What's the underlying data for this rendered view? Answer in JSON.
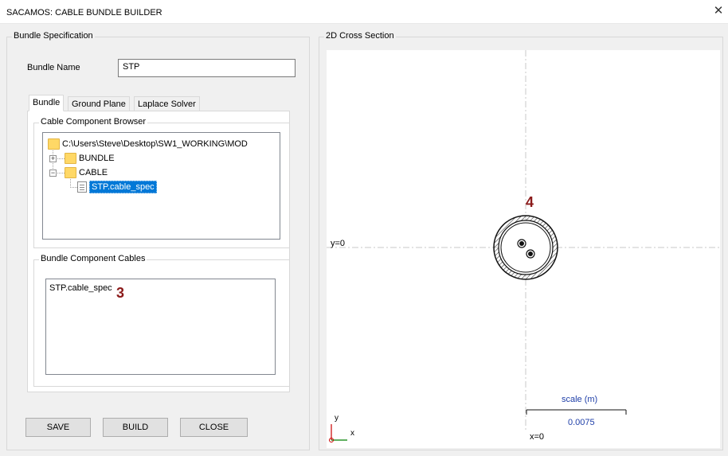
{
  "window": {
    "title": "SACAMOS: CABLE BUNDLE BUILDER",
    "close_glyph": "✕"
  },
  "bundle_spec": {
    "legend": "Bundle Specification",
    "name_label": "Bundle Name",
    "name_value": "STP",
    "tabs": [
      {
        "label": "Bundle",
        "active": true
      },
      {
        "label": "Ground Plane",
        "active": false
      },
      {
        "label": "Laplace Solver",
        "active": false
      }
    ],
    "browser": {
      "legend": "Cable Component Browser",
      "root": "C:\\Users\\Steve\\Desktop\\SW1_WORKING\\MOD",
      "items": [
        {
          "label": "BUNDLE",
          "expander": "+"
        },
        {
          "label": "CABLE",
          "expander": "−"
        }
      ],
      "selected_file": "STP.cable_spec"
    },
    "component_cables": {
      "legend": "Bundle Component Cables",
      "items": [
        "STP.cable_spec"
      ]
    },
    "buttons": {
      "save": "SAVE",
      "build": "BUILD",
      "close": "CLOSE"
    }
  },
  "annotations": {
    "list_marker": "3",
    "cross_section_marker": "4"
  },
  "cross_section": {
    "legend": "2D Cross Section",
    "y_axis_label": "y=0",
    "x_axis_label": "x=0",
    "scale_label": "scale (m)",
    "scale_value": "0.0075",
    "axis_y": "y",
    "axis_x": "x"
  },
  "colors": {
    "accent_text": "#1f3fa8",
    "annotation": "#8b1a1a",
    "axis_red": "#cc0000",
    "axis_green": "#008000"
  }
}
